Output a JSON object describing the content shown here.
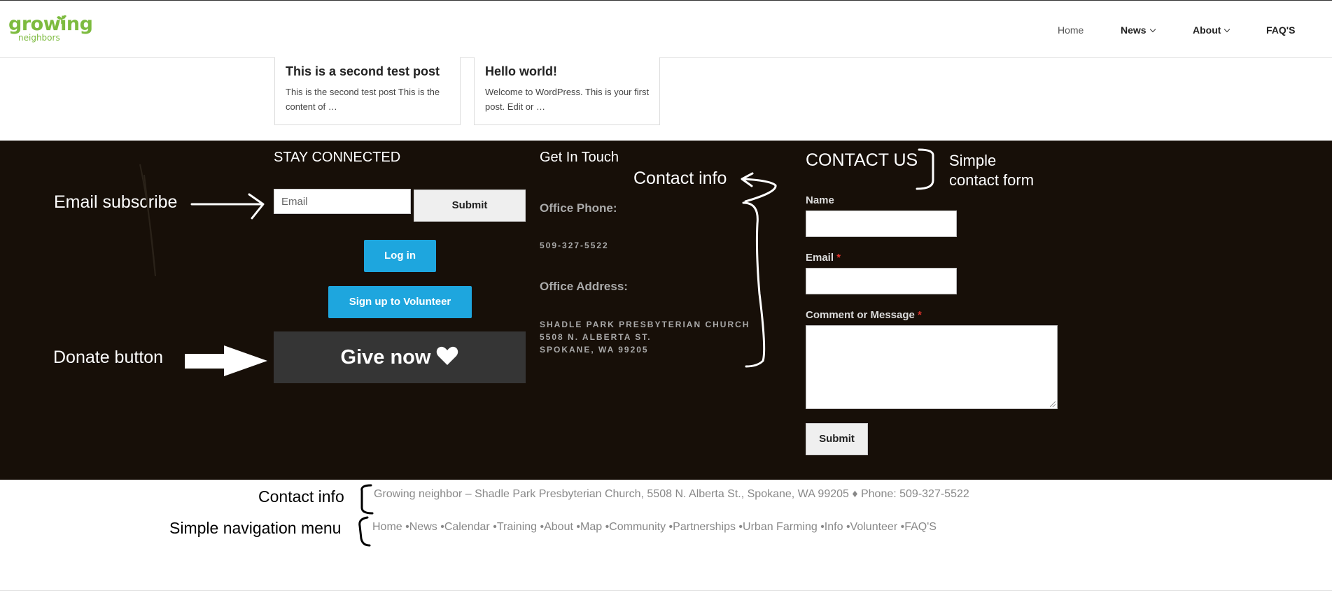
{
  "header": {
    "logo_word": "growing",
    "logo_sub": "neighbors",
    "nav": [
      {
        "label": "Home"
      },
      {
        "label": "News"
      },
      {
        "label": "About"
      },
      {
        "label": "FAQ'S"
      }
    ]
  },
  "posts": [
    {
      "title": "This is a second test post",
      "excerpt": "This is the second test post This is the content of …"
    },
    {
      "title": "Hello world!",
      "excerpt": "Welcome to WordPress. This is your first post. Edit or …"
    }
  ],
  "stay_connected": {
    "title": "STAY CONNECTED",
    "email_placeholder": "Email",
    "submit_label": "Submit",
    "login_label": "Log in",
    "volunteer_label": "Sign up to Volunteer",
    "give_label": "Give now",
    "colors": {
      "blue": "#1ea6de",
      "give_bg": "#353535",
      "footer_bg": "#170f08"
    }
  },
  "get_in_touch": {
    "title": "Get In Touch",
    "phone_label": "Office Phone:",
    "phone": "509-327-5522",
    "address_label": "Office Address:",
    "address_lines": [
      "SHADLE PARK PRESBYTERIAN CHURCH",
      "5508 N. ALBERTA ST.",
      "SPOKANE, WA 99205"
    ]
  },
  "contact_form": {
    "title": "CONTACT US",
    "name_label": "Name",
    "email_label": "Email",
    "message_label": "Comment or Message",
    "required_mark": "*",
    "submit_label": "Submit"
  },
  "annotations": {
    "email_subscribe": "Email subscribe",
    "donate_button": "Donate button",
    "contact_info": "Contact info",
    "simple_contact_form_1": "Simple",
    "simple_contact_form_2": "contact form",
    "contact_info_bottom": "Contact info",
    "simple_navigation_menu": "Simple navigation menu"
  },
  "footer": {
    "contact_line": "Growing neighbor – Shadle Park Presbyterian Church, 5508 N. Alberta St., Spokane, WA 99205 ♦ Phone: 509-327-5522",
    "nav": [
      "Home",
      "News",
      "Calendar",
      "Training",
      "About",
      "Map",
      "Community",
      "Partnerships",
      "Urban Farming",
      "Info",
      "Volunteer",
      "FAQ'S"
    ]
  }
}
